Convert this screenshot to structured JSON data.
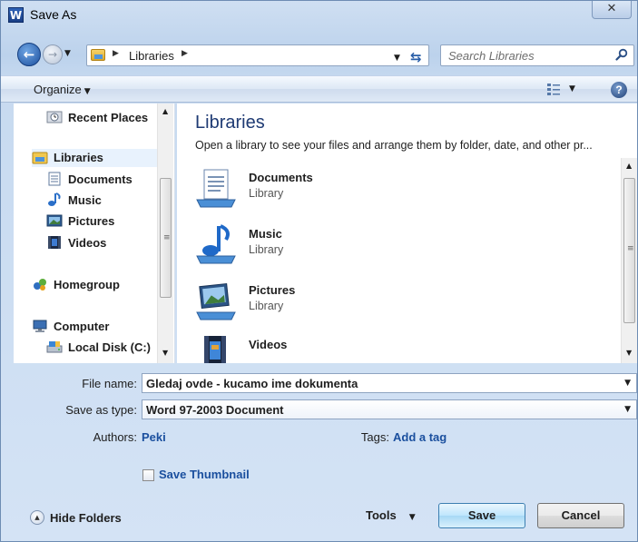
{
  "window": {
    "title": "Save As",
    "app_icon_letter": "W",
    "close_glyph": "✕"
  },
  "nav": {
    "breadcrumb": [
      "Libraries"
    ],
    "search_placeholder": "Search Libraries"
  },
  "toolbar": {
    "organize_label": "Organize"
  },
  "sidebar": {
    "items": [
      {
        "label": "Recent Places",
        "icon": "recent-places-icon"
      },
      {
        "label": "Libraries",
        "icon": "libraries-icon",
        "selected": true
      },
      {
        "label": "Documents",
        "icon": "documents-icon"
      },
      {
        "label": "Music",
        "icon": "music-icon"
      },
      {
        "label": "Pictures",
        "icon": "pictures-icon"
      },
      {
        "label": "Videos",
        "icon": "videos-icon"
      },
      {
        "label": "Homegroup",
        "icon": "homegroup-icon"
      },
      {
        "label": "Computer",
        "icon": "computer-icon"
      },
      {
        "label": "Local Disk (C:)",
        "icon": "local-disk-icon"
      }
    ]
  },
  "content": {
    "title": "Libraries",
    "subtitle": "Open a library to see your files and arrange them by folder, date, and other pr...",
    "libraries": [
      {
        "name": "Documents",
        "type": "Library",
        "icon": "documents-library-icon"
      },
      {
        "name": "Music",
        "type": "Library",
        "icon": "music-library-icon"
      },
      {
        "name": "Pictures",
        "type": "Library",
        "icon": "pictures-library-icon"
      },
      {
        "name": "Videos",
        "type": "",
        "icon": "videos-library-icon"
      }
    ]
  },
  "form": {
    "file_name_label": "File name:",
    "file_name_value": "Gledaj ovde - kucamo ime dokumenta",
    "save_type_label": "Save as type:",
    "save_type_value": "Word 97-2003 Document",
    "authors_label": "Authors:",
    "authors_value": "Peki",
    "tags_label": "Tags:",
    "tags_value": "Add a tag",
    "thumbnail_label": "Save Thumbnail",
    "thumbnail_checked": false
  },
  "footer": {
    "hide_folders_label": "Hide Folders",
    "tools_label": "Tools",
    "save_label": "Save",
    "cancel_label": "Cancel"
  },
  "colors": {
    "link": "#1a4f9e",
    "title_blue": "#1e3a73",
    "chrome": "#c7daf0"
  }
}
